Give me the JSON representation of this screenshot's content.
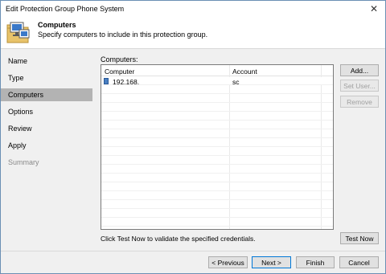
{
  "window": {
    "title": "Edit Protection Group Phone System"
  },
  "header": {
    "title": "Computers",
    "subtitle": "Specify computers to include in this protection group."
  },
  "sidebar": {
    "items": [
      {
        "label": "Name",
        "state": "normal"
      },
      {
        "label": "Type",
        "state": "normal"
      },
      {
        "label": "Computers",
        "state": "active"
      },
      {
        "label": "Options",
        "state": "normal"
      },
      {
        "label": "Review",
        "state": "normal"
      },
      {
        "label": "Apply",
        "state": "normal"
      },
      {
        "label": "Summary",
        "state": "disabled"
      }
    ]
  },
  "computers": {
    "section_label": "Computers:",
    "columns": [
      "Computer",
      "Account"
    ],
    "rows": [
      {
        "computer": "192.168.",
        "account": "sc"
      }
    ]
  },
  "side_buttons": {
    "add": "Add...",
    "set_user": "Set User...",
    "remove": "Remove"
  },
  "hint": "Click Test Now to validate the specified credentials.",
  "test_now": "Test Now",
  "footer": {
    "previous": "< Previous",
    "next": "Next >",
    "finish": "Finish",
    "cancel": "Cancel"
  },
  "colors": {
    "active_nav": "#b3b3b3",
    "primary_border": "#0078d7",
    "computer_icon": "#4a7fc1"
  }
}
